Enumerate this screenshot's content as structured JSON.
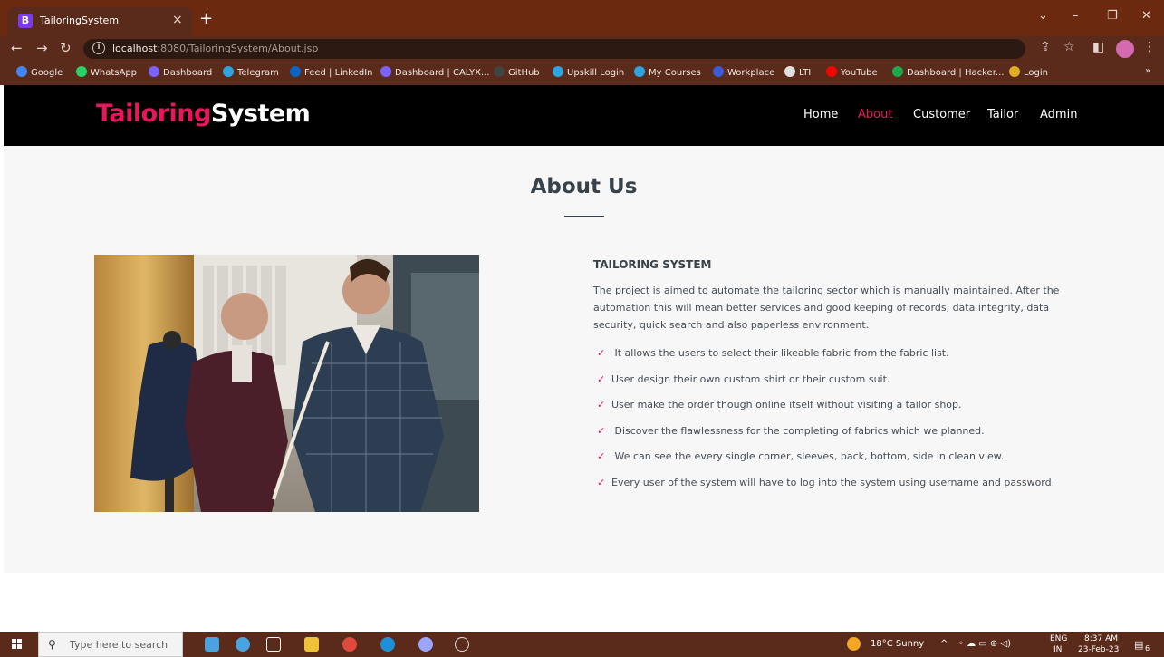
{
  "browser": {
    "tab_icon": "B",
    "tab_title": "TailoringSystem",
    "tab_close": "×",
    "new_tab": "+",
    "url_host": "localhost",
    "url_path": ":8080/TailoringSystem/About.jsp",
    "bookmarks": [
      "Google",
      "WhatsApp",
      "Dashboard",
      "Telegram",
      "Feed | LinkedIn",
      "Dashboard | CALYX...",
      "GitHub",
      "Upskill Login",
      "My Courses",
      "Workplace",
      "LTI",
      "YouTube",
      "Dashboard | Hacker...",
      "Login"
    ],
    "bookmark_colors": [
      "#4285f4",
      "#25d366",
      "#7b61ff",
      "#2ca5e0",
      "#0a66c2",
      "#7b61ff",
      "#444444",
      "#2ca5e0",
      "#2ca5e0",
      "#3b5bdb",
      "#e0e0e0",
      "#ff0000",
      "#1ba94c",
      "#e0b020"
    ],
    "more_bookmarks": "»"
  },
  "site": {
    "logo_part1": "Tailoring",
    "logo_part2": "System",
    "nav": [
      "Home",
      "About",
      "Customer",
      "Tailor",
      "Admin"
    ],
    "active_nav": "About",
    "accent_color": "#e8175d"
  },
  "about": {
    "title": "About Us",
    "heading": "TAILORING SYSTEM",
    "paragraph": "The project is aimed to automate the tailoring sector which is manually maintained. After the automation this will mean better services and good keeping of records, data integrity, data security, quick search and also paperless environment.",
    "check_icon": "✓",
    "features": [
      " It allows the users to select their likeable fabric from the fabric list.",
      "User design their own custom shirt or their custom suit.",
      "User make the order though online itself without visiting a tailor shop.",
      " Discover the flawlessness for the completing of fabrics which we planned.",
      " We can see the every single corner, sleeves, back, bottom, side in clean view.",
      "Every user of the system will have to log into the system using username and password."
    ]
  },
  "taskbar": {
    "search_placeholder": "Type here to search",
    "weather": "18°C  Sunny",
    "lang_top": "ENG",
    "lang_bottom": "IN",
    "time": "8:37 AM",
    "date": "23-Feb-23",
    "notification_count": "6"
  }
}
